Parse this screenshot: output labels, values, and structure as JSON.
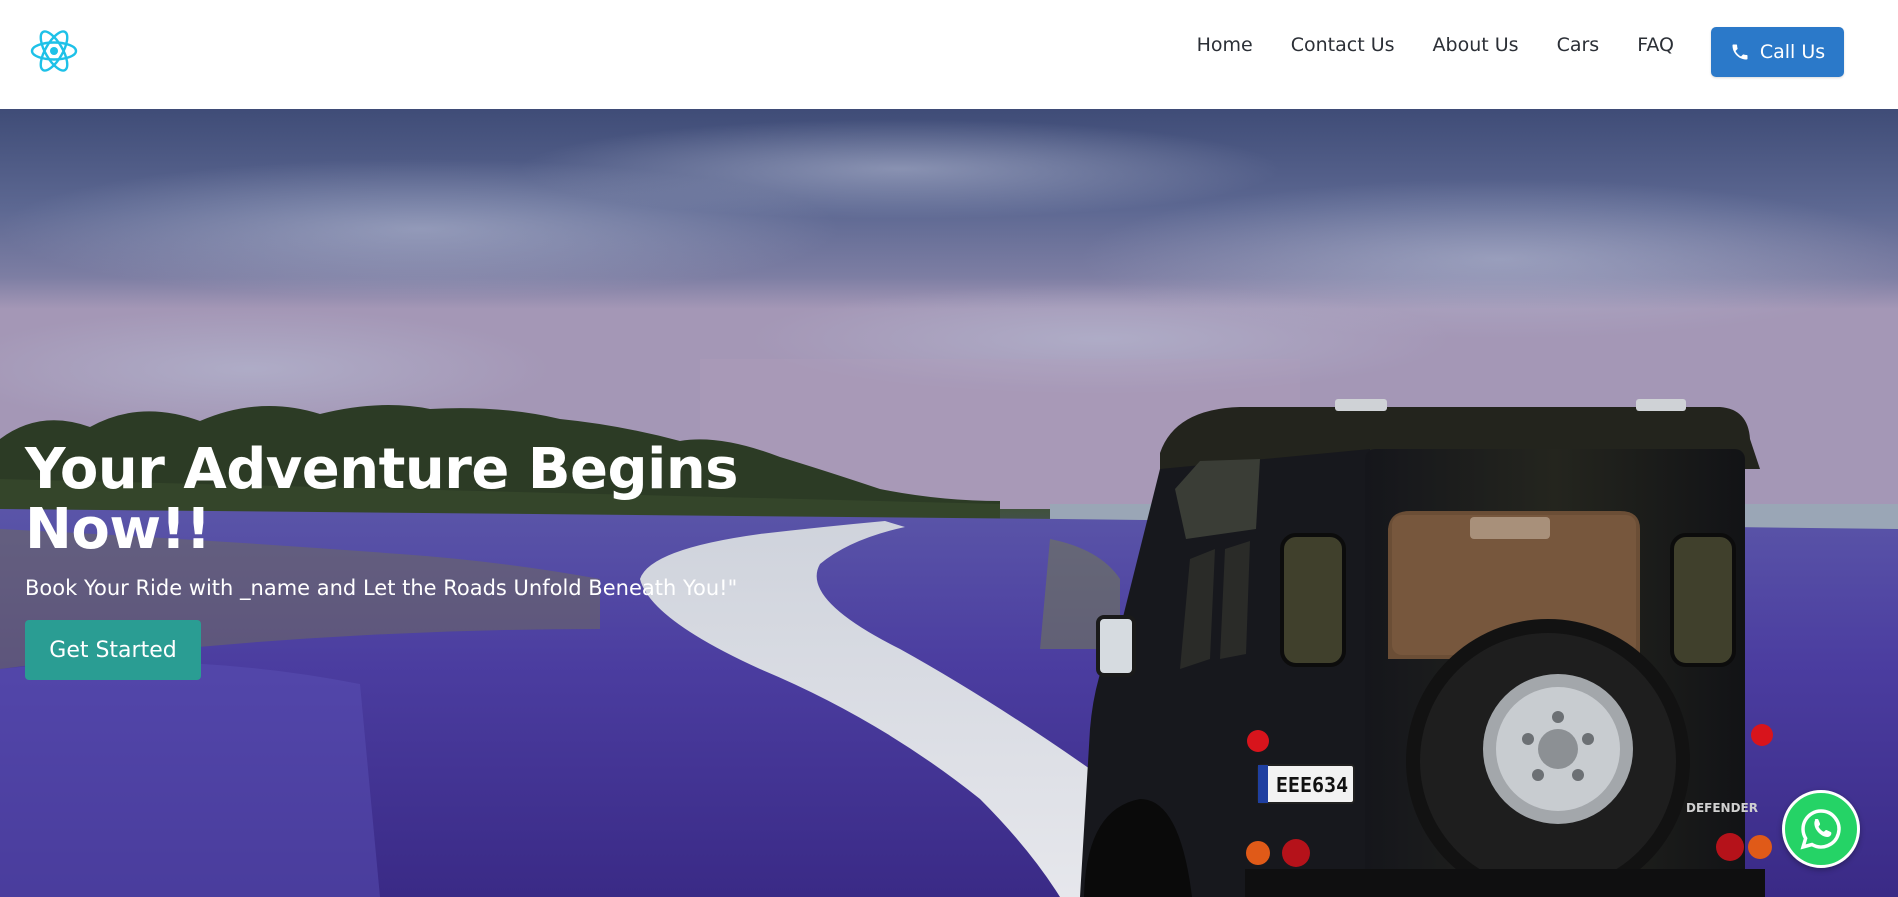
{
  "navbar": {
    "logo_icon": "react-atom-icon",
    "links": [
      {
        "label": "Home"
      },
      {
        "label": "Contact Us"
      },
      {
        "label": "About Us"
      },
      {
        "label": "Cars"
      },
      {
        "label": "FAQ"
      }
    ],
    "call_button": {
      "label": "Call Us",
      "icon": "phone-icon",
      "color": "#2b79c9"
    }
  },
  "hero": {
    "title": "Your Adventure Begins Now!!",
    "subtitle": "Book Your Ride with _name and Let the Roads Unfold Beneath You!\"",
    "cta_label": "Get Started",
    "cta_color": "#2a9d93",
    "plate": "EEE634",
    "badge": "DEFENDER"
  },
  "whatsapp": {
    "icon": "whatsapp-icon",
    "color": "#25d366"
  }
}
